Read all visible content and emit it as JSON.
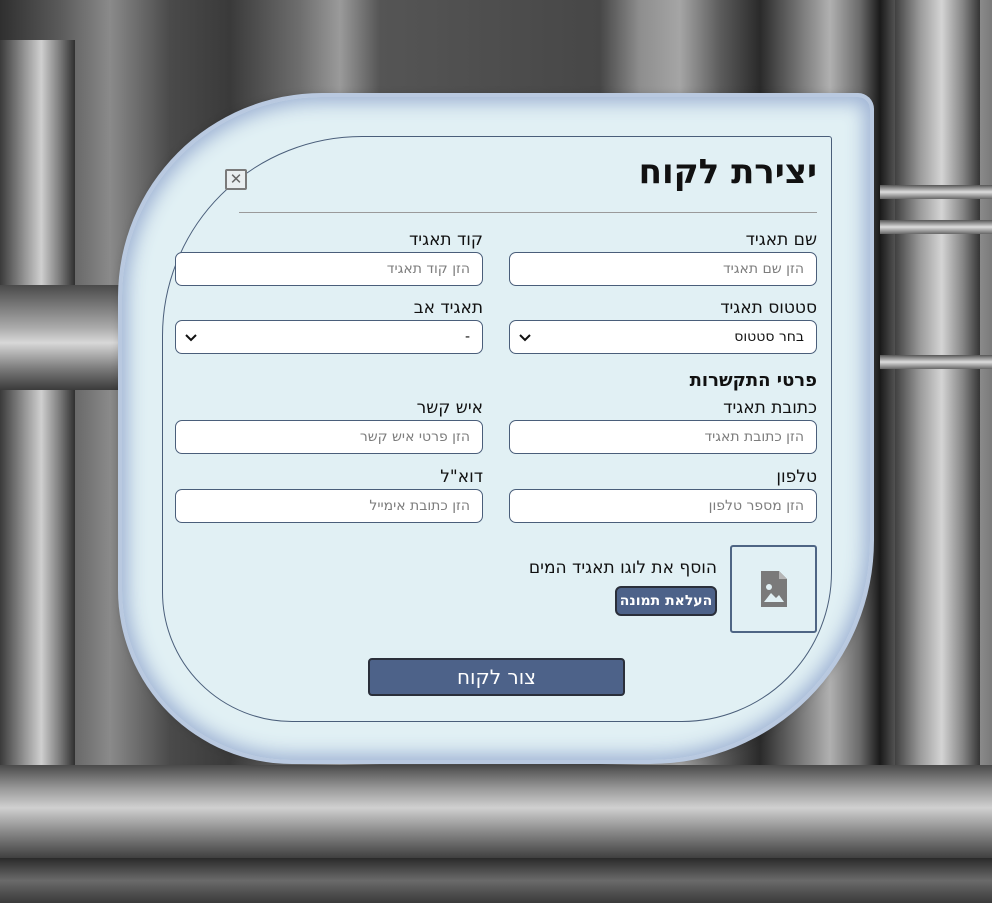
{
  "dialog": {
    "title": "יצירת לקוח",
    "close_icon": "close-icon",
    "fields": {
      "corp_name_label": "שם תאגיד",
      "corp_name_placeholder": "הזן שם תאגיד",
      "corp_code_label": "קוד תאגיד",
      "corp_code_placeholder": "הזן קוד תאגיד",
      "corp_status_label": "סטטוס תאגיד",
      "corp_status_value": "בחר סטטוס",
      "parent_corp_label": "תאגיד אב",
      "parent_corp_value": "-"
    },
    "contact_section_title": "פרטי התקשרות",
    "contact": {
      "address_label": "כתובת תאגיד",
      "address_placeholder": "הזן כתובת תאגיד",
      "contact_person_label": "איש קשר",
      "contact_person_placeholder": "הזן פרטי איש קשר",
      "phone_label": "טלפון",
      "phone_placeholder": "הזן מספר טלפון",
      "email_label": "דוא\"ל",
      "email_placeholder": "הזן כתובת אימייל"
    },
    "logo": {
      "text": "הוסף את לוגו תאגיד המים",
      "upload_label": "העלאת תמונה",
      "icon": "image-file-icon"
    },
    "submit_label": "צור לקוח"
  },
  "colors": {
    "dialog_bg": "#e1f0f4",
    "border": "#4a5e7a",
    "button_bg": "#4d6289"
  }
}
